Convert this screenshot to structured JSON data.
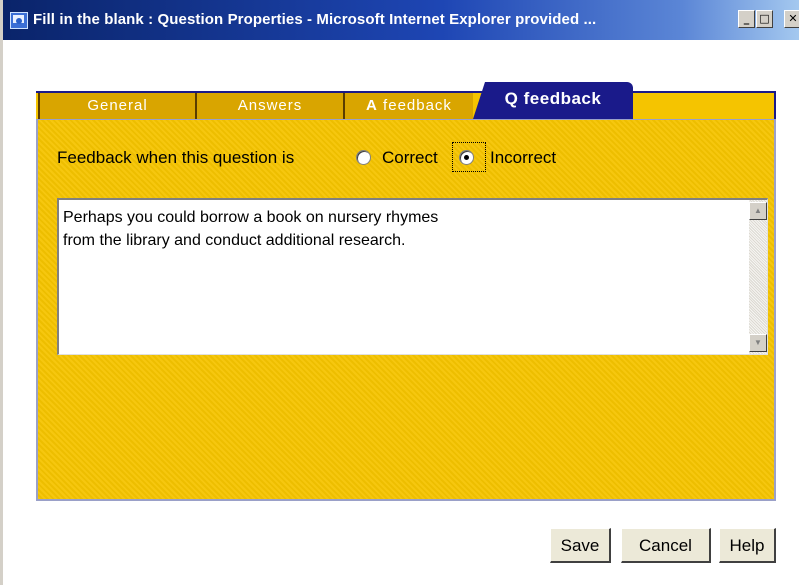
{
  "window": {
    "title": "Fill in the blank : Question Properties - Microsoft Internet Explorer provided ...",
    "controls": {
      "minimize_icon": "minimize-icon",
      "maximize_icon": "maximize-icon",
      "close_icon": "close-icon"
    }
  },
  "tabs": [
    {
      "label": "General",
      "active": false
    },
    {
      "label": "Answers",
      "active": false
    },
    {
      "label_prefix": "A",
      "label": " feedback",
      "active": false
    },
    {
      "label": "Q feedback",
      "active": true
    }
  ],
  "feedback": {
    "prompt": "Feedback when this question is",
    "options": [
      {
        "label": "Correct",
        "selected": false
      },
      {
        "label": "Incorrect",
        "selected": true
      }
    ],
    "text": "Perhaps you could borrow a book on nursery rhymes\nfrom the library and conduct additional research."
  },
  "buttons": {
    "save": "Save",
    "cancel": "Cancel",
    "help": "Help"
  },
  "colors": {
    "panel": "#f5c400",
    "active_tab": "#1a1a8a",
    "title_bar": "#0a246a"
  }
}
